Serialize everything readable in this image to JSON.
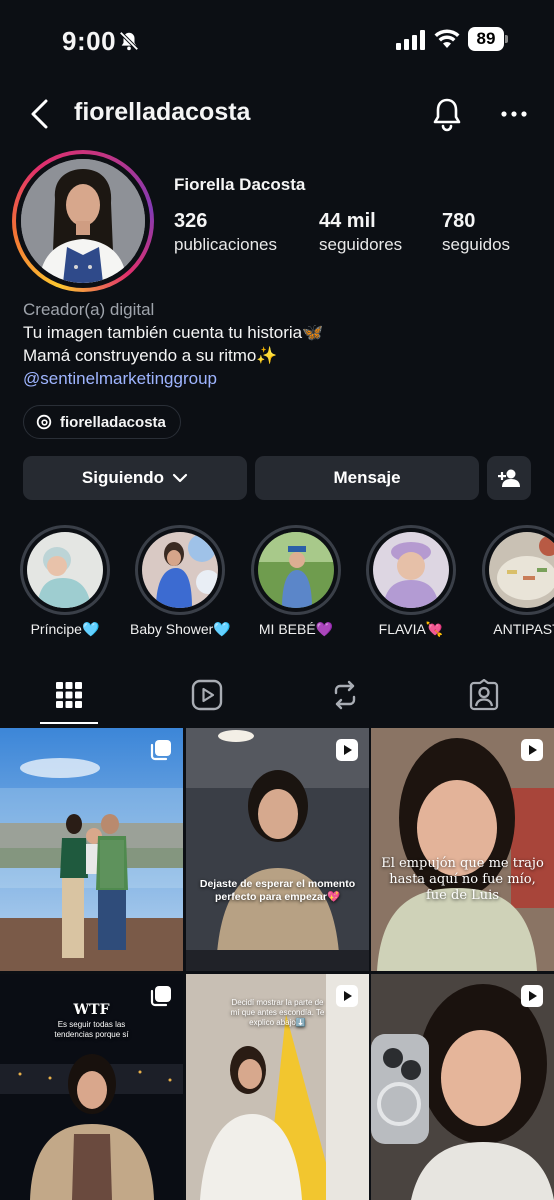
{
  "status_bar": {
    "time": "9:00",
    "battery": "89"
  },
  "header": {
    "username": "fiorelladacosta"
  },
  "profile": {
    "name": "Fiorella Dacosta",
    "stats": [
      {
        "value": "326",
        "label": "publicaciones"
      },
      {
        "value": "44 mil",
        "label": "seguidores"
      },
      {
        "value": "780",
        "label": "seguidos"
      }
    ],
    "category": "Creador(a) digital",
    "bio_line1": "Tu imagen también cuenta tu historia🦋",
    "bio_line2": "Mamá construyendo a su ritmo✨",
    "bio_link": "@sentinelmarketinggroup",
    "threads_handle": "fiorelladacosta"
  },
  "actions": {
    "following_label": "Siguiendo",
    "message_label": "Mensaje"
  },
  "highlights": [
    {
      "label": "Príncipe🩵"
    },
    {
      "label": "Baby Shower🩵"
    },
    {
      "label": "MI BEBÉ💜"
    },
    {
      "label": "FLAVIA💘"
    },
    {
      "label": "ANTIPAST"
    }
  ],
  "tabs": [
    "grid",
    "reels",
    "reposts",
    "tagged"
  ],
  "posts": [
    {
      "type": "carousel",
      "text": ""
    },
    {
      "type": "reel",
      "text": "Dejaste de esperar el momento perfecto para empezar💖"
    },
    {
      "type": "reel",
      "text": "El empujón que me trajo hasta aquí no fue mío, fue de Luis"
    },
    {
      "type": "carousel",
      "title": "WTF",
      "text": "Es seguir todas las tendencias porque sí"
    },
    {
      "type": "reel",
      "text": "Decidí mostrar la parte de mí que antes escondía. Te explico abajo⬇️"
    },
    {
      "type": "reel",
      "text": ""
    }
  ],
  "colors": {
    "background": "#0c0f14",
    "button": "#262a31",
    "link": "#9fb5ff",
    "muted": "#9ea3ab"
  }
}
